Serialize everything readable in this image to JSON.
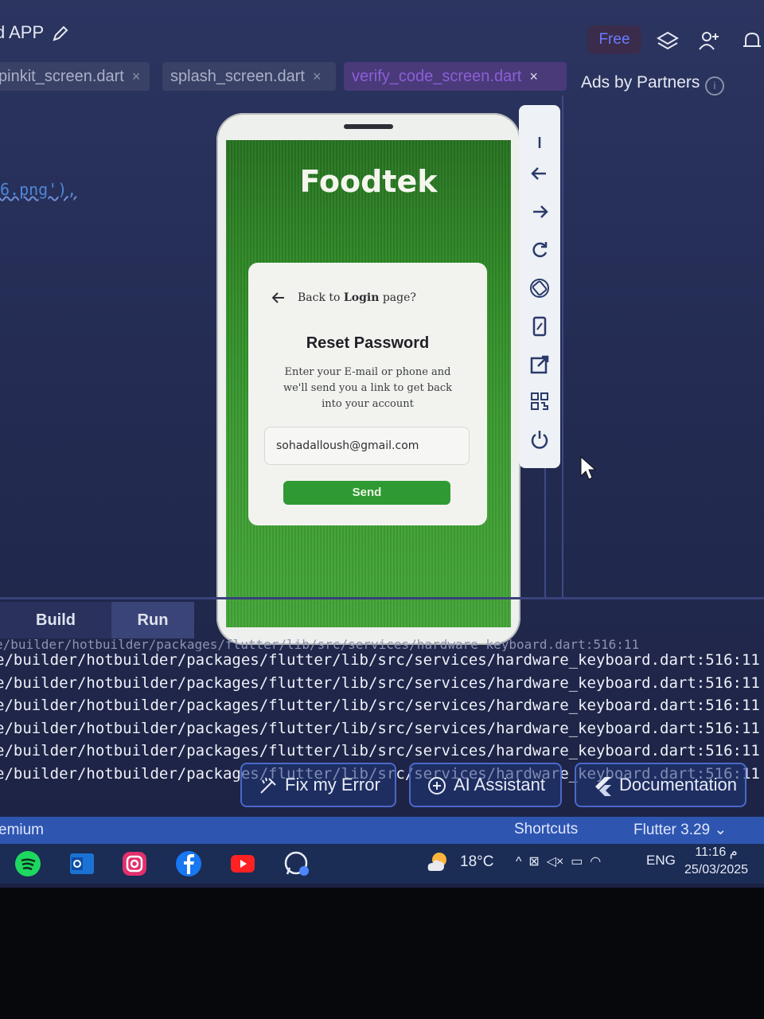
{
  "topbar": {
    "app_title": "d APP",
    "free_label": "Free"
  },
  "tabs": [
    {
      "label": "pinkit_screen.dart"
    },
    {
      "label": "splash_screen.dart"
    },
    {
      "label": "verify_code_screen.dart"
    }
  ],
  "ads_label": "Ads by Partners",
  "info_label": "i",
  "code_fragment": "6.png'),",
  "phone": {
    "brand": "Foodtek",
    "card": {
      "back_text_pre": "Back to ",
      "back_text_link": "Login",
      "back_text_post": " page?",
      "title": "Reset Password",
      "description": "Enter your E-mail or phone and we'll send you a link to get back into your account",
      "email_value": "sohadalloush@gmail.com",
      "send_label": "Send"
    }
  },
  "panel": {
    "build_label": "Build",
    "run_label": "Run",
    "log_lines": [
      "e/builder/hotbuilder/packages/flutter/lib/src/services/hardware_keyboard.dart:516:11",
      "e/builder/hotbuilder/packages/flutter/lib/src/services/hardware_keyboard.dart:516:11",
      "e/builder/hotbuilder/packages/flutter/lib/src/services/hardware_keyboard.dart:516:11",
      "e/builder/hotbuilder/packages/flutter/lib/src/services/hardware_keyboard.dart:516:11",
      "e/builder/hotbuilder/packages/flutter/lib/src/services/hardware_keyboard.dart:516:11",
      "e/builder/hotbuilder/packages/flutter/lib/src/services/hardware_keyboard.dart:516:11"
    ],
    "faded_line": "e/builder/hotbuilder/packages/flutter/lib/src/services/hardware_keyboard.dart:516:11"
  },
  "actions": {
    "fix_label": "Fix my Error",
    "ai_label": "AI Assistant",
    "docs_label": "Documentation"
  },
  "statusbar": {
    "left_label": "emium",
    "shortcuts_label": "Shortcuts",
    "flutter_label": "Flutter 3.29 ⌄"
  },
  "taskbar": {
    "temperature": "18°C",
    "language": "ENG",
    "time": "11:16 م",
    "date": "25/03/2025"
  },
  "icons": [
    "pencil-icon",
    "layers-icon",
    "add-user-icon",
    "bell-icon",
    "info-icon",
    "back-arrow-icon",
    "arrow-left-icon",
    "arrow-right-icon",
    "refresh-icon",
    "rotate-icon",
    "phone-frame-icon",
    "open-external-icon",
    "qr-code-icon",
    "power-icon",
    "cursor-icon",
    "fix-icon",
    "ai-icon",
    "flutter-icon",
    "spotify-icon",
    "outlook-icon",
    "instagram-icon",
    "facebook-icon",
    "youtube-icon",
    "whatsapp-icon",
    "weather-icon"
  ],
  "colors": {
    "accent_green": "#2f9a33",
    "ide_background": "#232b52",
    "statusbar_blue": "#2e56b0",
    "free_purple": "#6a7bff"
  }
}
